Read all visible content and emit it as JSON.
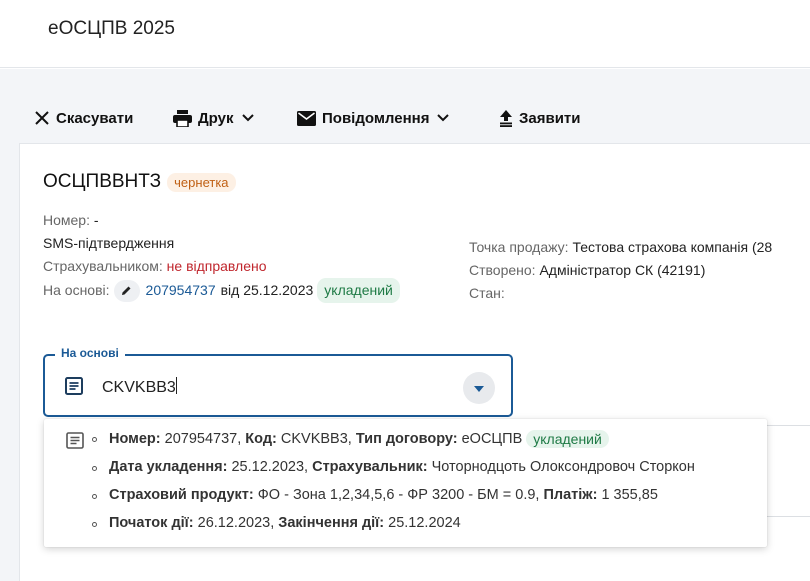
{
  "app": {
    "title": "еОСЦПВ 2025"
  },
  "toolbar": {
    "cancel_label": "Скасувати",
    "print_label": "Друк",
    "notify_label": "Повідомлення",
    "declare_label": "Заявити"
  },
  "document": {
    "title": "ОСЦПВВНТЗ",
    "status_badge": "чернетка",
    "number_label": "Номер:",
    "number_value": "-",
    "sms_label": "SMS-підтвердження",
    "insurer_label": "Страхувальником:",
    "insurer_value": "не відправлено",
    "basis_label": "На основі:",
    "basis_number": "207954737",
    "basis_date_text": "від 25.12.2023",
    "basis_status": "укладений",
    "sale_point_label": "Точка продажу:",
    "sale_point_value": "Тестова страхова компанія (28",
    "created_label": "Створено:",
    "created_value": "Адміністратор СК (42191)",
    "state_label": "Стан:"
  },
  "basis_field": {
    "legend": "На основі",
    "value": "CKVKBB3"
  },
  "dropdown": {
    "option": {
      "number_label": "Номер:",
      "number_value": "207954737,",
      "code_label": "Код:",
      "code_value": "CKVKBB3,",
      "type_label": "Тип договору:",
      "type_value": "еОСЦПВ",
      "status": "укладений",
      "concluded_label": "Дата укладення:",
      "concluded_value": "25.12.2023,",
      "holder_label": "Страхувальник:",
      "holder_value": "Чоторнодцоть Олоксондровоч Сторкон",
      "product_label": "Страховий продукт:",
      "product_value": "ФО - Зона 1,2,34,5,6 - ФР 3200 - БМ = 0.9,",
      "payment_label": "Платіж:",
      "payment_value": "1 355,85",
      "start_label": "Початок дії:",
      "start_value": "26.12.2023,",
      "end_label": "Закінчення дії:",
      "end_value": "25.12.2024"
    }
  },
  "colors": {
    "accent": "#1b5a96",
    "draft_badge_bg": "#fdf0e4",
    "draft_badge_fg": "#c06014",
    "ok_badge_bg": "#e6f4ec",
    "ok_badge_fg": "#1e7a45",
    "error_text": "#c0262d"
  },
  "icons": {
    "cancel": "close-icon",
    "print": "printer-icon",
    "notify": "envelope-icon",
    "declare": "upload-icon",
    "field": "document-icon",
    "dropdown_toggle": "caret-down-icon",
    "edit": "pencil-icon"
  }
}
